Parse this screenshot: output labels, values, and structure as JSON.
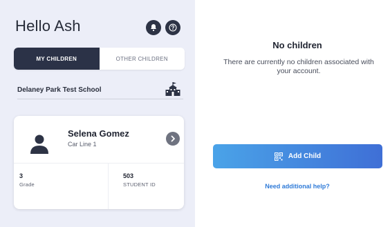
{
  "header": {
    "greeting": "Hello Ash"
  },
  "icons": {
    "bell": "bell-icon",
    "help": "help-icon",
    "school": "school-icon",
    "avatar": "user-icon",
    "chevron": "chevron-right-icon",
    "qr": "qr-code-icon"
  },
  "tabs": {
    "my_children": "MY CHILDREN",
    "other_children": "OTHER CHILDREN"
  },
  "school": {
    "name": "Delaney Park Test School"
  },
  "child": {
    "name": "Selena Gomez",
    "subtitle": "Car Line 1",
    "grade_value": "3",
    "grade_label": "Grade",
    "student_id_value": "503",
    "student_id_label": "STUDENT ID"
  },
  "empty_state": {
    "title": "No children",
    "message": "There are currently no children associated with your account.",
    "add_button": "Add Child",
    "help_link": "Need additional help?"
  },
  "colors": {
    "navy": "#2b3247",
    "accent_start": "#4aa3e8",
    "accent_end": "#3f6fd6",
    "link": "#2f7bd8",
    "panel_bg": "#eceef8"
  }
}
